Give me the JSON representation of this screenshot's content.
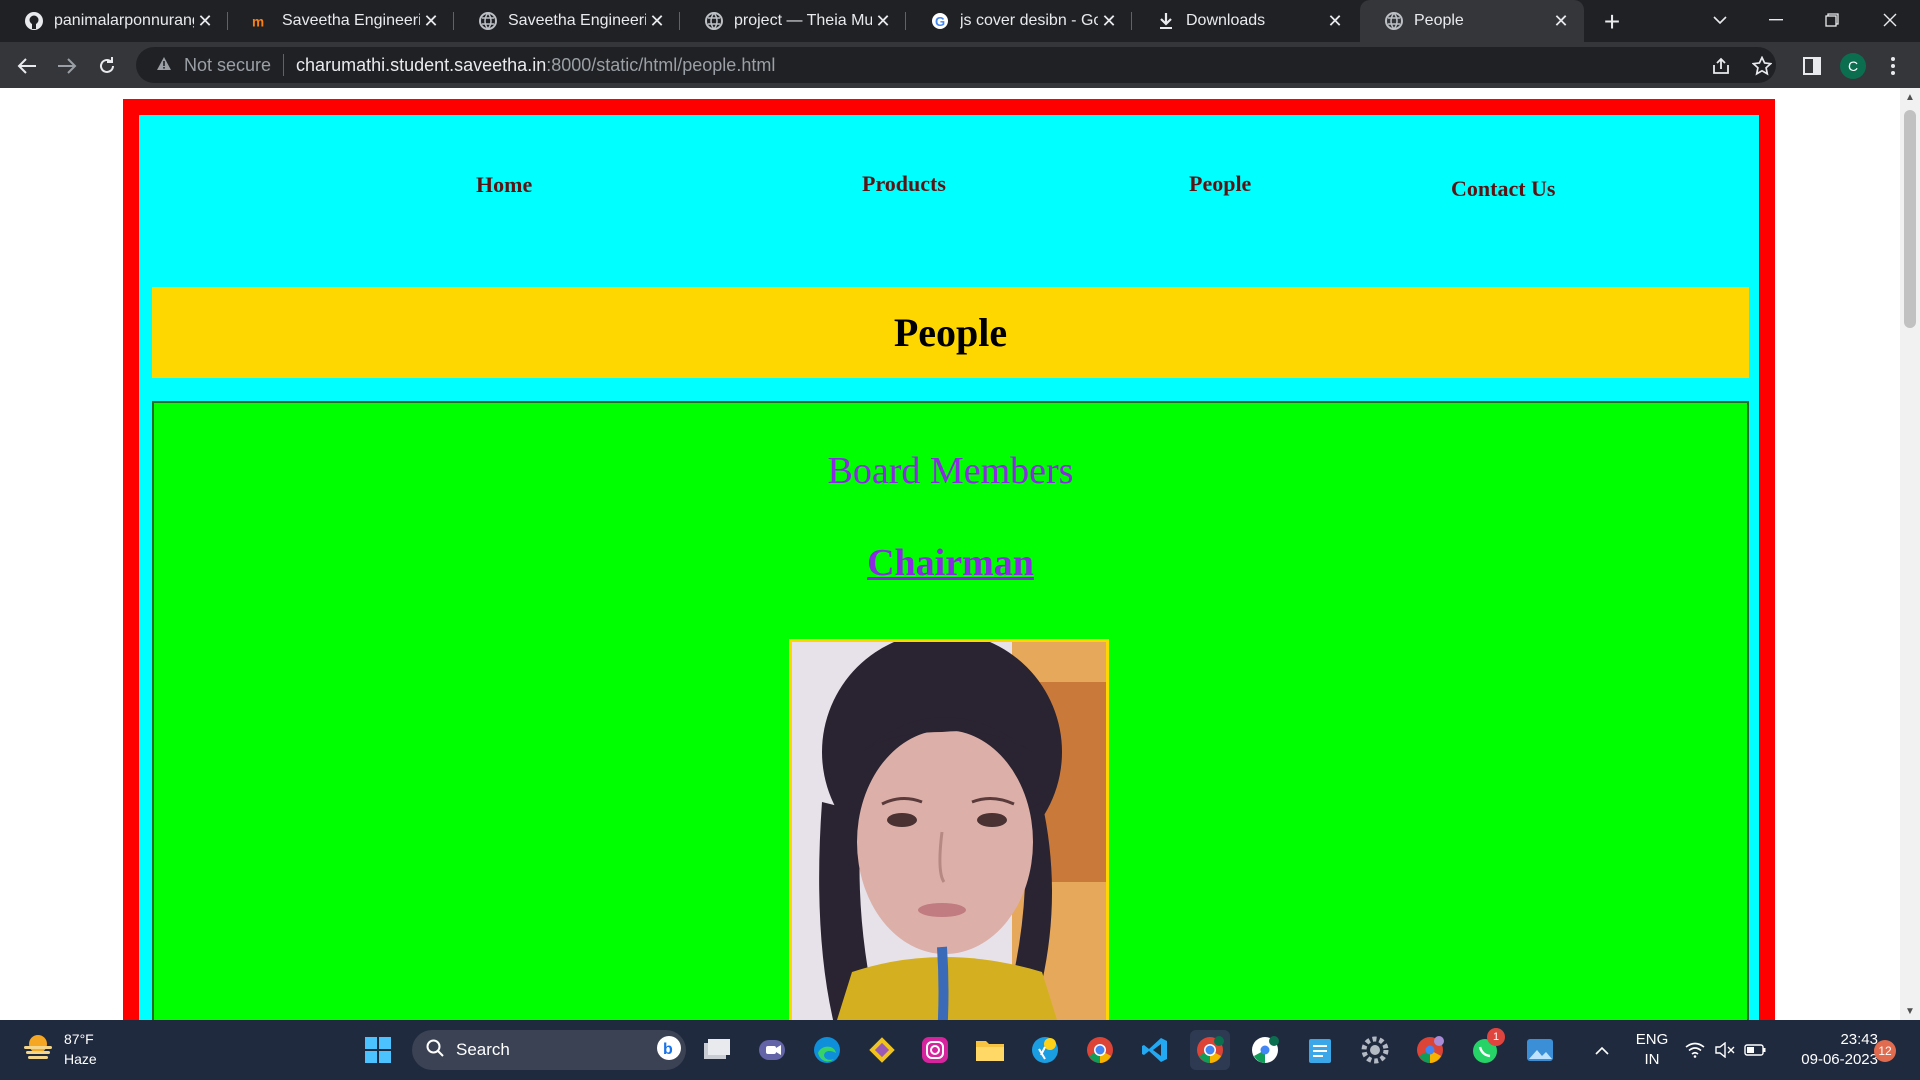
{
  "browser": {
    "tabs": [
      {
        "title": "panimalarponnuranga",
        "icon": "github-icon"
      },
      {
        "title": "Saveetha Engineering",
        "icon": "moodle-icon"
      },
      {
        "title": "Saveetha Engineering",
        "icon": "globe-icon"
      },
      {
        "title": "project — Theia Multi",
        "icon": "globe-icon"
      },
      {
        "title": "js cover desibn - Goo",
        "icon": "google-icon"
      },
      {
        "title": "Downloads",
        "icon": "download-icon"
      },
      {
        "title": "People",
        "icon": "globe-icon",
        "active": true
      }
    ],
    "address": {
      "security_label": "Not secure",
      "host": "charumathi.student.saveetha.in",
      "path": ":8000/static/html/people.html"
    },
    "profile_initial": "C"
  },
  "page": {
    "nav": [
      "Home",
      "Products",
      "People",
      "Contact Us"
    ],
    "banner_title": "People",
    "section_title": "Board Members",
    "role_title": "Chairman"
  },
  "taskbar": {
    "weather": {
      "temp": "87°F",
      "condition": "Haze"
    },
    "search_label": "Search",
    "lang": {
      "line1": "ENG",
      "line2": "IN"
    },
    "clock": {
      "time": "23:43",
      "date": "09-06-2023"
    },
    "notification_count": "12",
    "whatsapp_badge": "1"
  },
  "colors": {
    "frame": "#ff0000",
    "nav_bg": "#00ffff",
    "banner": "#ffd700",
    "content": "#00ff00",
    "heading": "#8a2be2"
  }
}
